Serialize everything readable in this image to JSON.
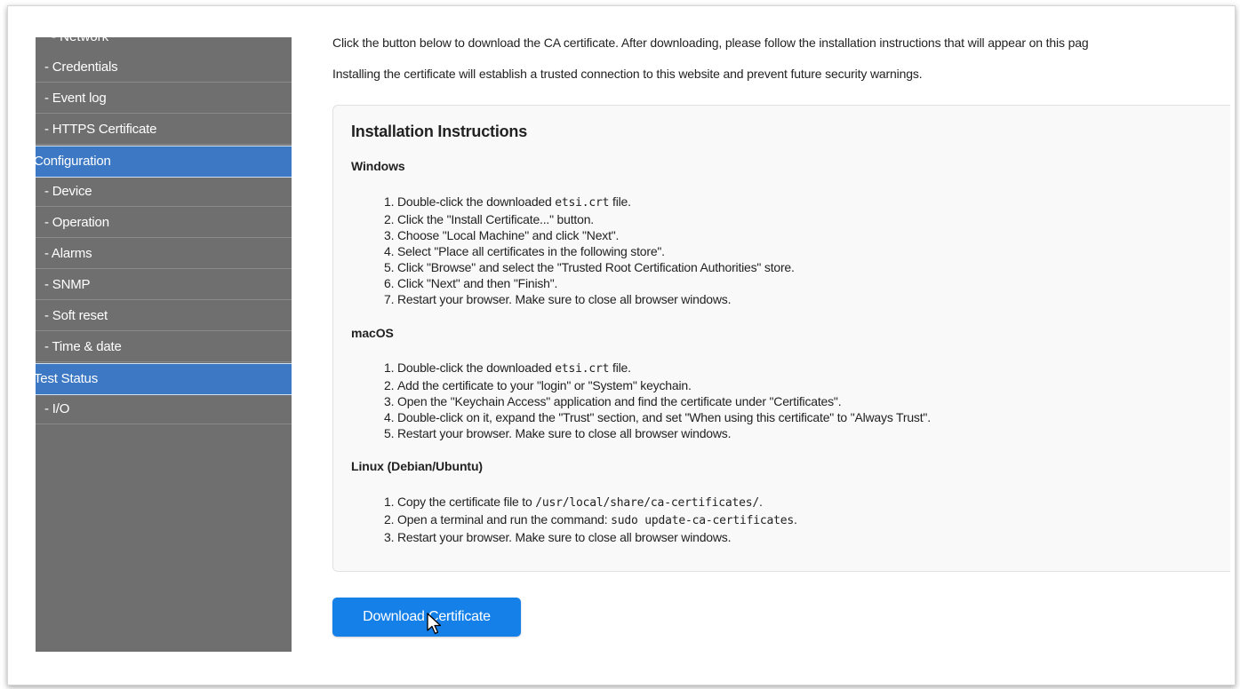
{
  "sidebar": {
    "clipped_top_item": "- Network",
    "items": [
      {
        "label": "- Credentials",
        "type": "item"
      },
      {
        "label": "- Event log",
        "type": "item"
      },
      {
        "label": "- HTTPS Certificate",
        "type": "item"
      },
      {
        "label": "Configuration",
        "type": "section"
      },
      {
        "label": "- Device",
        "type": "item"
      },
      {
        "label": "- Operation",
        "type": "item"
      },
      {
        "label": "- Alarms",
        "type": "item"
      },
      {
        "label": "- SNMP",
        "type": "item"
      },
      {
        "label": "- Soft reset",
        "type": "item"
      },
      {
        "label": "- Time & date",
        "type": "item"
      },
      {
        "label": "Test Status",
        "type": "section"
      },
      {
        "label": "- I/O",
        "type": "item"
      }
    ]
  },
  "main": {
    "intro_line1": "Click the button below to download the CA certificate. After downloading, please follow the installation instructions that will appear on this pag",
    "intro_line2": "Installing the certificate will establish a trusted connection to this website and prevent future security warnings.",
    "instructions": {
      "title": "Installation Instructions",
      "windows": {
        "heading": "Windows",
        "steps": [
          [
            "Double-click the downloaded ",
            "etsi.crt",
            " file."
          ],
          [
            "Click the \"Install Certificate...\" button.",
            "",
            ""
          ],
          [
            "Choose \"Local Machine\" and click \"Next\".",
            "",
            ""
          ],
          [
            "Select \"Place all certificates in the following store\".",
            "",
            ""
          ],
          [
            "Click \"Browse\" and select the \"Trusted Root Certification Authorities\" store.",
            "",
            ""
          ],
          [
            "Click \"Next\" and then \"Finish\".",
            "",
            ""
          ],
          [
            "Restart your browser. Make sure to close all browser windows.",
            "",
            ""
          ]
        ]
      },
      "macos": {
        "heading": "macOS",
        "steps": [
          [
            "Double-click the downloaded ",
            "etsi.crt",
            " file."
          ],
          [
            "Add the certificate to your \"login\" or \"System\" keychain.",
            "",
            ""
          ],
          [
            "Open the \"Keychain Access\" application and find the certificate under \"Certificates\".",
            "",
            ""
          ],
          [
            "Double-click on it, expand the \"Trust\" section, and set \"When using this certificate\" to \"Always Trust\".",
            "",
            ""
          ],
          [
            "Restart your browser. Make sure to close all browser windows.",
            "",
            ""
          ]
        ]
      },
      "linux": {
        "heading": "Linux (Debian/Ubuntu)",
        "steps": [
          [
            "Copy the certificate file to ",
            "/usr/local/share/ca-certificates/",
            "."
          ],
          [
            "Open a terminal and run the command: ",
            "sudo update-ca-certificates",
            "."
          ],
          [
            "Restart your browser. Make sure to close all browser windows.",
            "",
            ""
          ]
        ]
      }
    },
    "download_button": "Download Certificate"
  },
  "colors": {
    "sidebar_bg": "#6f6f6f",
    "section_bg": "#3d78c4",
    "button_bg": "#1580e8"
  }
}
